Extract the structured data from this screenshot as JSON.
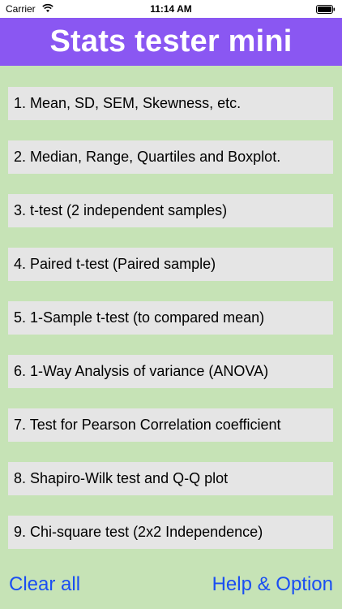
{
  "status_bar": {
    "carrier": "Carrier",
    "time": "11:14 AM"
  },
  "header": {
    "title": "Stats tester mini"
  },
  "menu": {
    "items": [
      {
        "label": "1. Mean, SD, SEM, Skewness, etc."
      },
      {
        "label": "2. Median, Range, Quartiles and Boxplot."
      },
      {
        "label": "3. t-test (2 independent samples)"
      },
      {
        "label": "4. Paired t-test (Paired sample)"
      },
      {
        "label": "5. 1-Sample t-test (to compared mean)"
      },
      {
        "label": "6. 1-Way Analysis of variance (ANOVA)"
      },
      {
        "label": "7. Test for Pearson Correlation coefficient"
      },
      {
        "label": "8. Shapiro-Wilk test and Q-Q plot"
      },
      {
        "label": "9. Chi-square test (2x2 Independence)"
      }
    ]
  },
  "footer": {
    "clear_label": "Clear all",
    "help_label": "Help & Option"
  },
  "colors": {
    "background": "#c6e3b6",
    "title_bar": "#8a57f2",
    "menu_item": "#e5e5e5",
    "link": "#1a4ef2"
  },
  "icons": {
    "wifi": "wifi-icon",
    "battery": "battery-icon"
  }
}
